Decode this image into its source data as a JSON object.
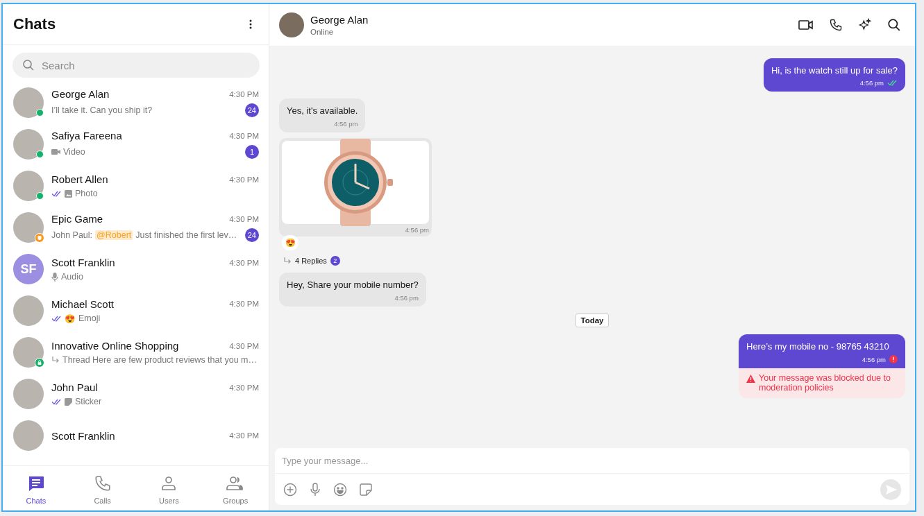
{
  "sidebar": {
    "title": "Chats",
    "search": {
      "placeholder": "Search"
    },
    "chats": [
      {
        "name": "George Alan",
        "time": "4:30 PM",
        "avatar": {
          "kind": "photo"
        },
        "badge": {
          "kind": "online"
        },
        "read_receipt": false,
        "preview": {
          "kind": "text",
          "text": "I’ll take it. Can you ship it?"
        },
        "unread": "24"
      },
      {
        "name": "Safiya Fareena",
        "time": "4:30 PM",
        "avatar": {
          "kind": "photo"
        },
        "badge": {
          "kind": "online"
        },
        "read_receipt": false,
        "preview": {
          "kind": "video",
          "text": "Video"
        },
        "unread": "1"
      },
      {
        "name": "Robert Allen",
        "time": "4:30 PM",
        "avatar": {
          "kind": "photo"
        },
        "badge": {
          "kind": "online"
        },
        "read_receipt": true,
        "preview": {
          "kind": "photo",
          "text": "Photo"
        }
      },
      {
        "name": "Epic Game",
        "time": "4:30 PM",
        "avatar": {
          "kind": "photo"
        },
        "badge": {
          "kind": "public"
        },
        "read_receipt": false,
        "preview": {
          "kind": "text",
          "sender": "John Paul:",
          "mention": "@Robert",
          "text": "Just finished the first lev…"
        },
        "unread": "24"
      },
      {
        "name": "Scott Franklin",
        "time": "4:30 PM",
        "avatar": {
          "kind": "initials",
          "initials": "SF"
        },
        "read_receipt": false,
        "preview": {
          "kind": "audio",
          "text": "Audio"
        }
      },
      {
        "name": "Michael Scott",
        "time": "4:30 PM",
        "avatar": {
          "kind": "photo"
        },
        "read_receipt": true,
        "preview": {
          "kind": "text",
          "emoji": "😍",
          "text": "Emoji"
        }
      },
      {
        "name": "Innovative Online Shopping",
        "time": "4:30 PM",
        "avatar": {
          "kind": "photo"
        },
        "badge": {
          "kind": "private"
        },
        "read_receipt": false,
        "preview": {
          "kind": "thread",
          "text": "Thread Here are few product reviews that you m…"
        }
      },
      {
        "name": "John Paul",
        "time": "4:30 PM",
        "avatar": {
          "kind": "photo"
        },
        "read_receipt": true,
        "preview": {
          "kind": "sticker",
          "text": "Sticker"
        }
      },
      {
        "name": "Scott Franklin",
        "time": "4:30 PM",
        "avatar": {
          "kind": "photo"
        }
      }
    ],
    "nav": [
      {
        "label": "Chats",
        "selected": true
      },
      {
        "label": "Calls",
        "selected": false
      },
      {
        "label": "Users",
        "selected": false
      },
      {
        "label": "Groups",
        "selected": false
      }
    ]
  },
  "conversation": {
    "header": {
      "name": "George Alan",
      "status": "Online"
    },
    "messages": [
      {
        "kind": "outgoing",
        "text": "Hi, is the watch still up for sale?",
        "time": "4:56 pm",
        "status": {
          "kind": "read"
        }
      },
      {
        "kind": "incoming",
        "text": "Yes, it's available.",
        "time": "4:56 pm"
      },
      {
        "kind": "image",
        "time": "4:56 pm",
        "reaction": "😍",
        "replies": "4 Replies",
        "reply_count": "2"
      },
      {
        "kind": "incoming",
        "text": "Hey, Share your mobile number?",
        "time": "4:56 pm"
      },
      {
        "kind": "date",
        "text": "Today"
      },
      {
        "kind": "outgoing",
        "text": "Here’s my mobile no - 98765 43210",
        "time": "4:56 pm",
        "status": {
          "kind": "failed"
        },
        "notice": "Your message was blocked due to moderation policies"
      }
    ],
    "composer": {
      "placeholder": "Type your message..."
    }
  }
}
